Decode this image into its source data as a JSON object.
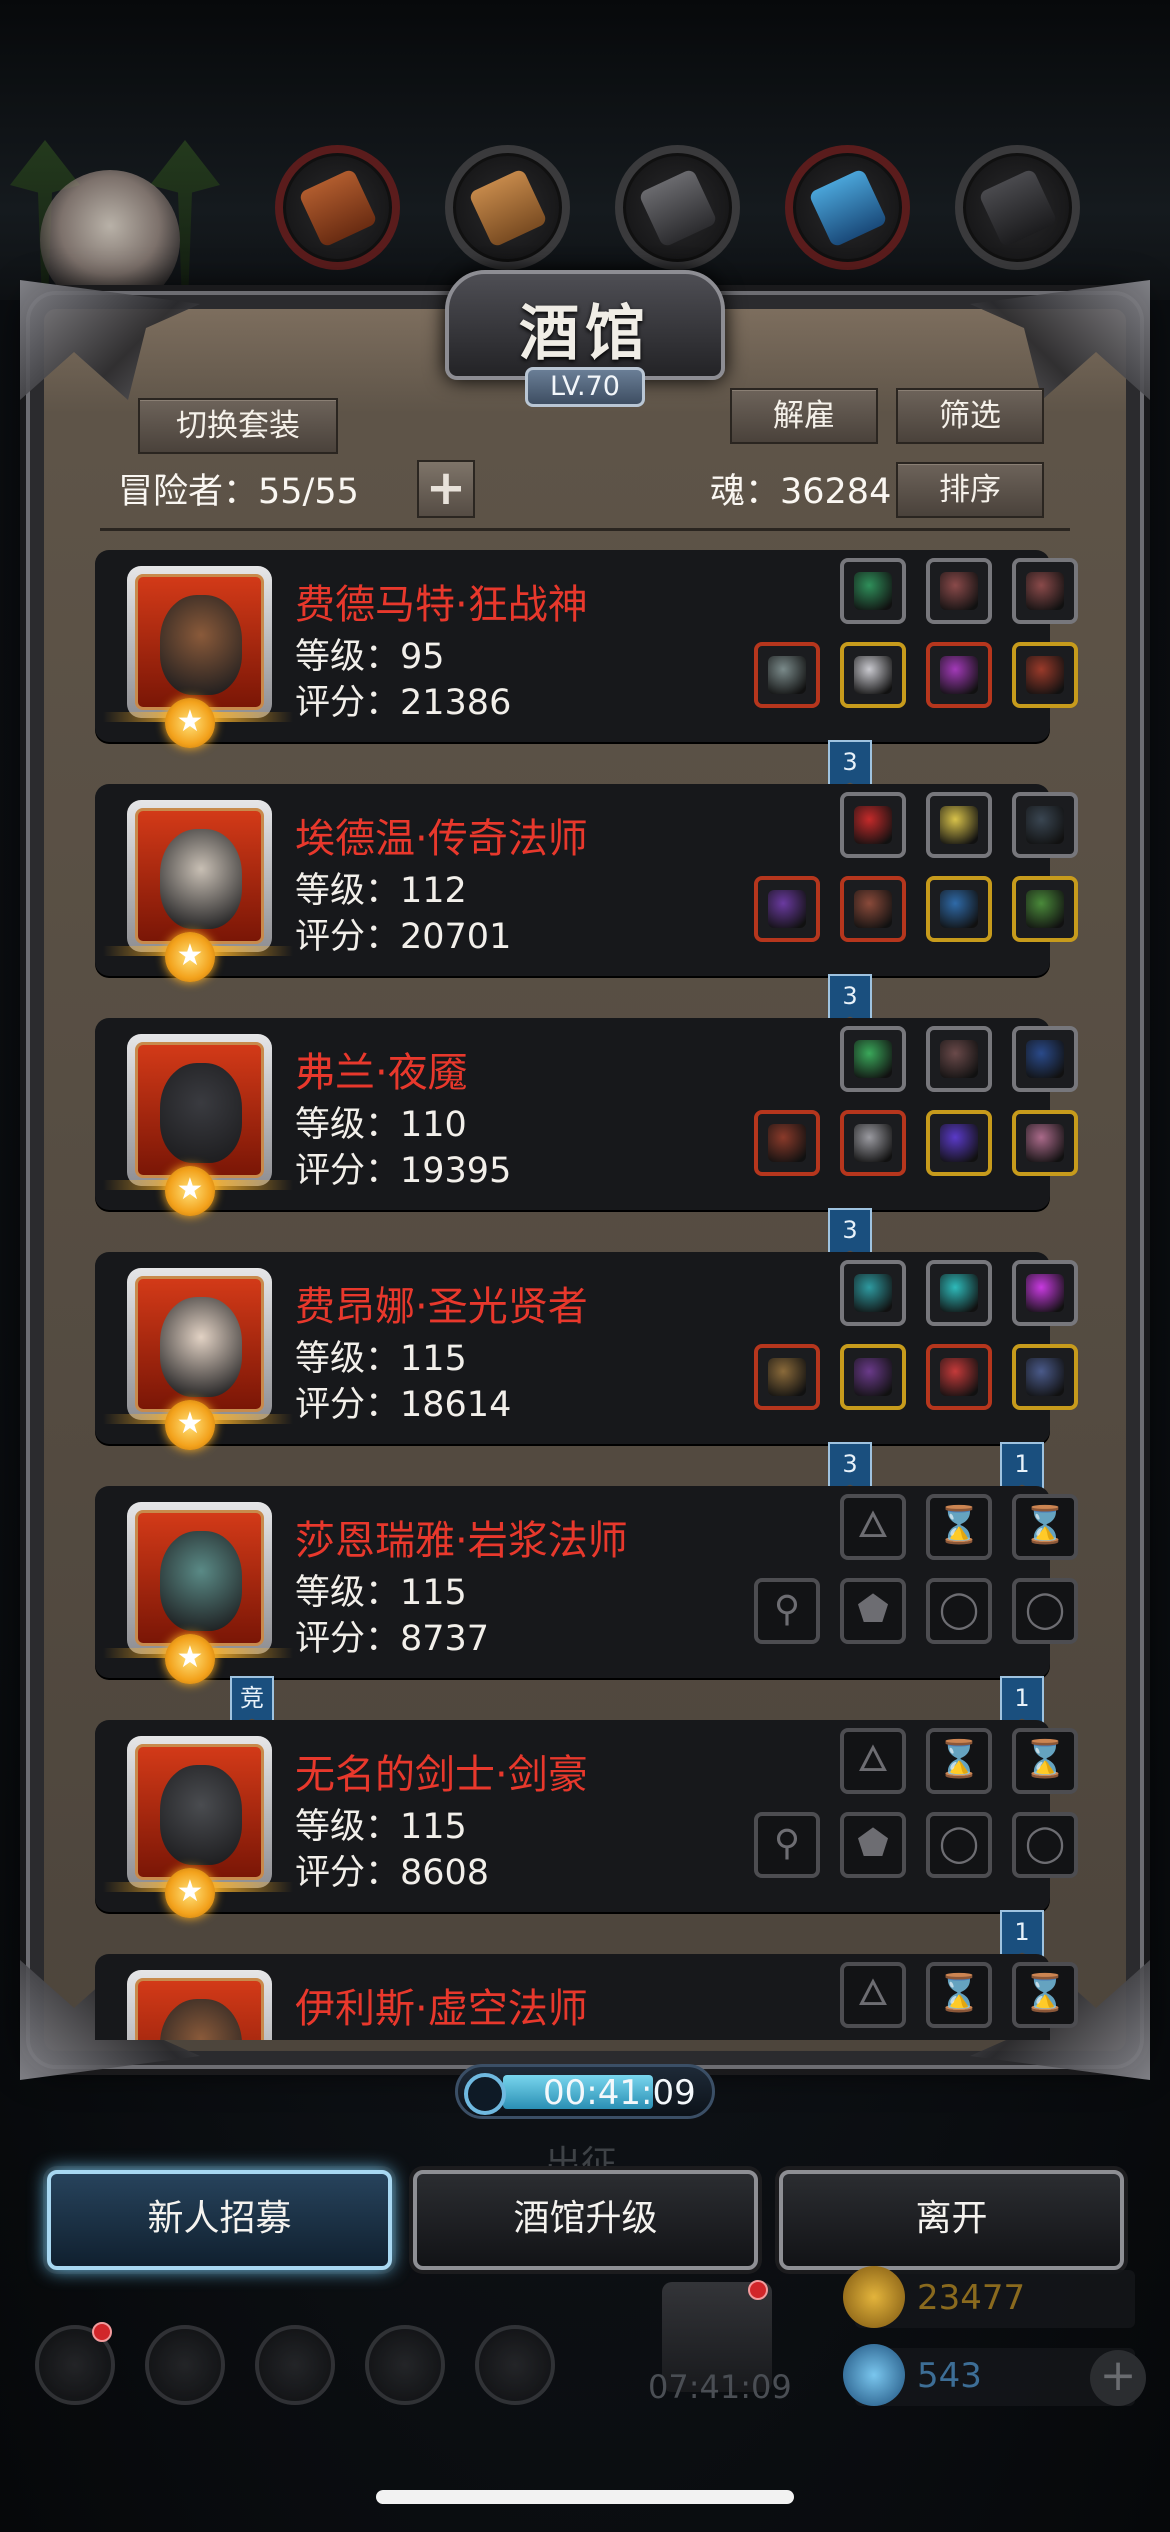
{
  "window": {
    "title": "酒馆",
    "level_badge": "LV.70"
  },
  "header": {
    "switch_set_label": "切换套装",
    "dismiss_label": "解雇",
    "filter_label": "筛选",
    "sort_label": "排序",
    "adventurers_text": "冒险者：55/55",
    "add_label": "+",
    "soul_text": "魂：36284"
  },
  "heroes": [
    {
      "name": "费德马特·狂战神",
      "level": "等级：95",
      "score": "评分：21386",
      "top_slots": [
        "grey",
        "grey",
        "grey"
      ],
      "bottom_slots": [
        "red",
        "gold",
        "red",
        "gold"
      ],
      "tags": [
        {
          "text": "3"
        }
      ]
    },
    {
      "name": "埃德温·传奇法师",
      "level": "等级：112",
      "score": "评分：20701",
      "top_slots": [
        "grey",
        "grey",
        "grey"
      ],
      "bottom_slots": [
        "red",
        "red",
        "gold",
        "gold"
      ],
      "tags": [
        {
          "text": "3"
        }
      ]
    },
    {
      "name": "弗兰·夜魇",
      "level": "等级：110",
      "score": "评分：19395",
      "top_slots": [
        "grey",
        "grey",
        "grey"
      ],
      "bottom_slots": [
        "red",
        "red",
        "gold",
        "gold"
      ],
      "tags": [
        {
          "text": "3"
        }
      ]
    },
    {
      "name": "费昂娜·圣光贤者",
      "level": "等级：115",
      "score": "评分：18614",
      "top_slots": [
        "grey",
        "grey",
        "grey"
      ],
      "bottom_slots": [
        "red",
        "gold",
        "red",
        "gold"
      ],
      "tags": [
        {
          "text": "3"
        },
        {
          "text": "1"
        }
      ]
    },
    {
      "name": "莎恩瑞雅·岩浆法师",
      "level": "等级：115",
      "score": "评分：8737",
      "top_slots": [
        "empty",
        "empty",
        "empty"
      ],
      "bottom_slots": [
        "empty",
        "empty",
        "empty",
        "empty"
      ],
      "tags": [
        {
          "text": "竞"
        },
        {
          "text": "1"
        }
      ]
    },
    {
      "name": "无名的剑士·剑豪",
      "level": "等级：115",
      "score": "评分：8608",
      "top_slots": [
        "empty",
        "empty",
        "empty"
      ],
      "bottom_slots": [
        "empty",
        "empty",
        "empty",
        "empty"
      ],
      "tags": [
        {
          "text": "1"
        }
      ]
    },
    {
      "name": "伊利斯·虚空法师",
      "level": "",
      "score": "",
      "top_slots": [
        "empty",
        "empty",
        "empty"
      ],
      "bottom_slots": [],
      "tags": []
    }
  ],
  "timer": {
    "text": "00:41:09"
  },
  "bottom_buttons": {
    "recruit": "新人招募",
    "upgrade": "酒馆升级",
    "leave": "离开"
  },
  "dock": {
    "timer_text": "07:41:09",
    "gold_value": "23477",
    "gem_value": "543",
    "behind_text": "出征"
  },
  "colors": {
    "hero_name": "#e8382c",
    "panel": "#5e5448",
    "accent_blue": "#6bc2ec"
  }
}
